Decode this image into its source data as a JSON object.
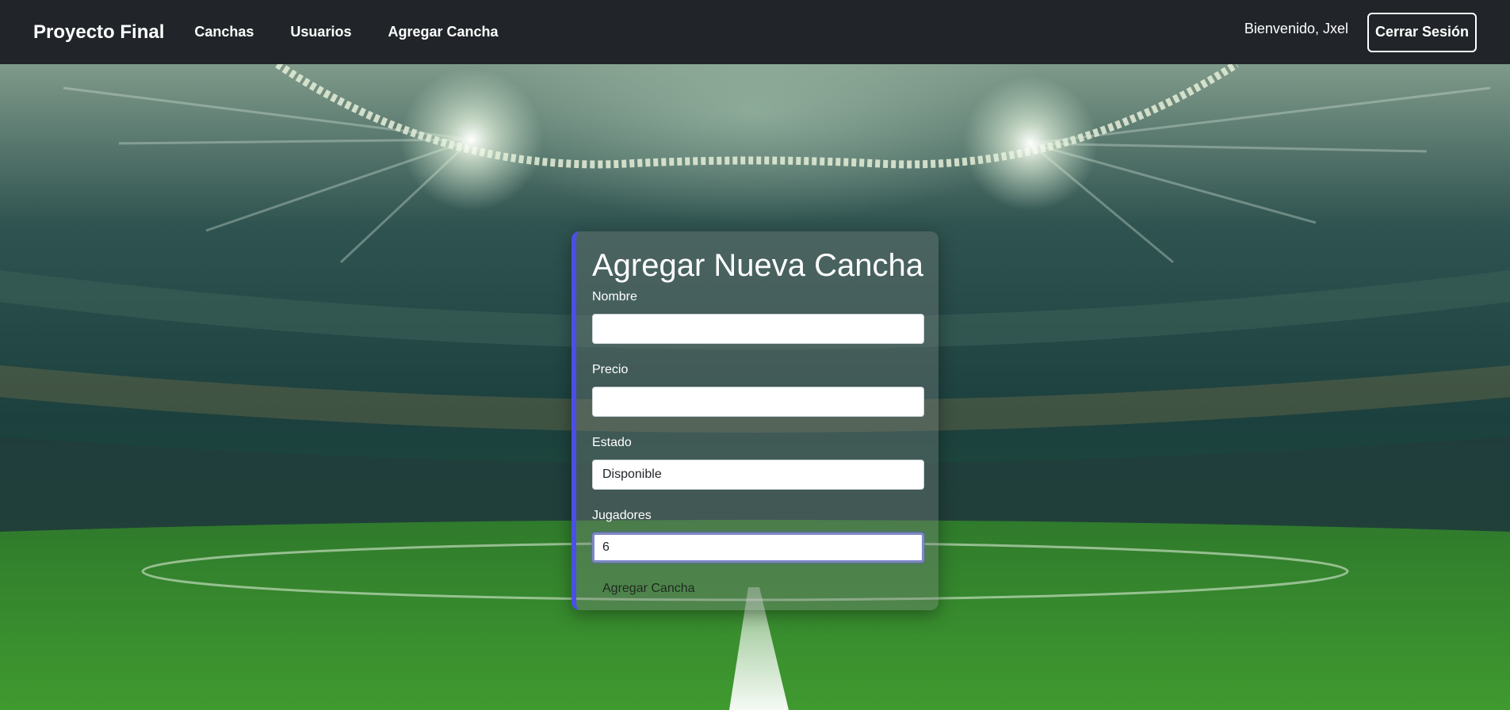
{
  "navbar": {
    "brand": "Proyecto Final",
    "links": [
      "Canchas",
      "Usuarios",
      "Agregar Cancha"
    ],
    "welcome": "Bienvenido, Jxel",
    "logout_label": "Cerrar Sesión"
  },
  "form": {
    "title": "Agregar Nueva Cancha",
    "fields": [
      {
        "label": "Nombre",
        "value": ""
      },
      {
        "label": "Precio",
        "value": ""
      },
      {
        "label": "Estado",
        "value": "Disponible"
      },
      {
        "label": "Jugadores",
        "value": "6"
      }
    ],
    "submit_label": "Agregar Cancha"
  },
  "colors": {
    "navbar_bg": "#212529",
    "card_accent": "#4b4fe8",
    "focus_ring": "#7e88c6"
  }
}
